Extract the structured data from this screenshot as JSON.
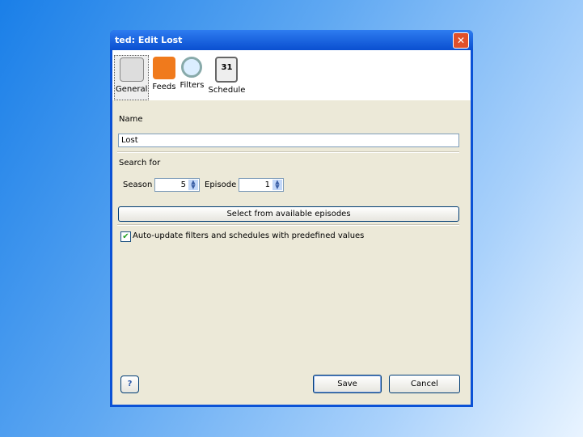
{
  "window": {
    "title": "ted: Edit Lost",
    "close": "✕"
  },
  "toolbar": [
    {
      "label": "General",
      "icon": "general-icon",
      "selected": true
    },
    {
      "label": "Feeds",
      "icon": "rss-icon"
    },
    {
      "label": "Filters",
      "icon": "magnifier-icon"
    },
    {
      "label": "Schedule",
      "icon": "calendar-icon",
      "day": "31"
    }
  ],
  "form": {
    "name_label": "Name",
    "name_value": "Lost",
    "search_label": "Search for",
    "season_label": "Season",
    "season_value": "5",
    "episode_label": "Episode",
    "episode_value": "1",
    "select_button": "Select from available episodes",
    "auto_update_label": "Auto-update filters and schedules with predefined values",
    "auto_update_checked": true
  },
  "footer": {
    "help": "?",
    "save": "Save",
    "cancel": "Cancel"
  }
}
